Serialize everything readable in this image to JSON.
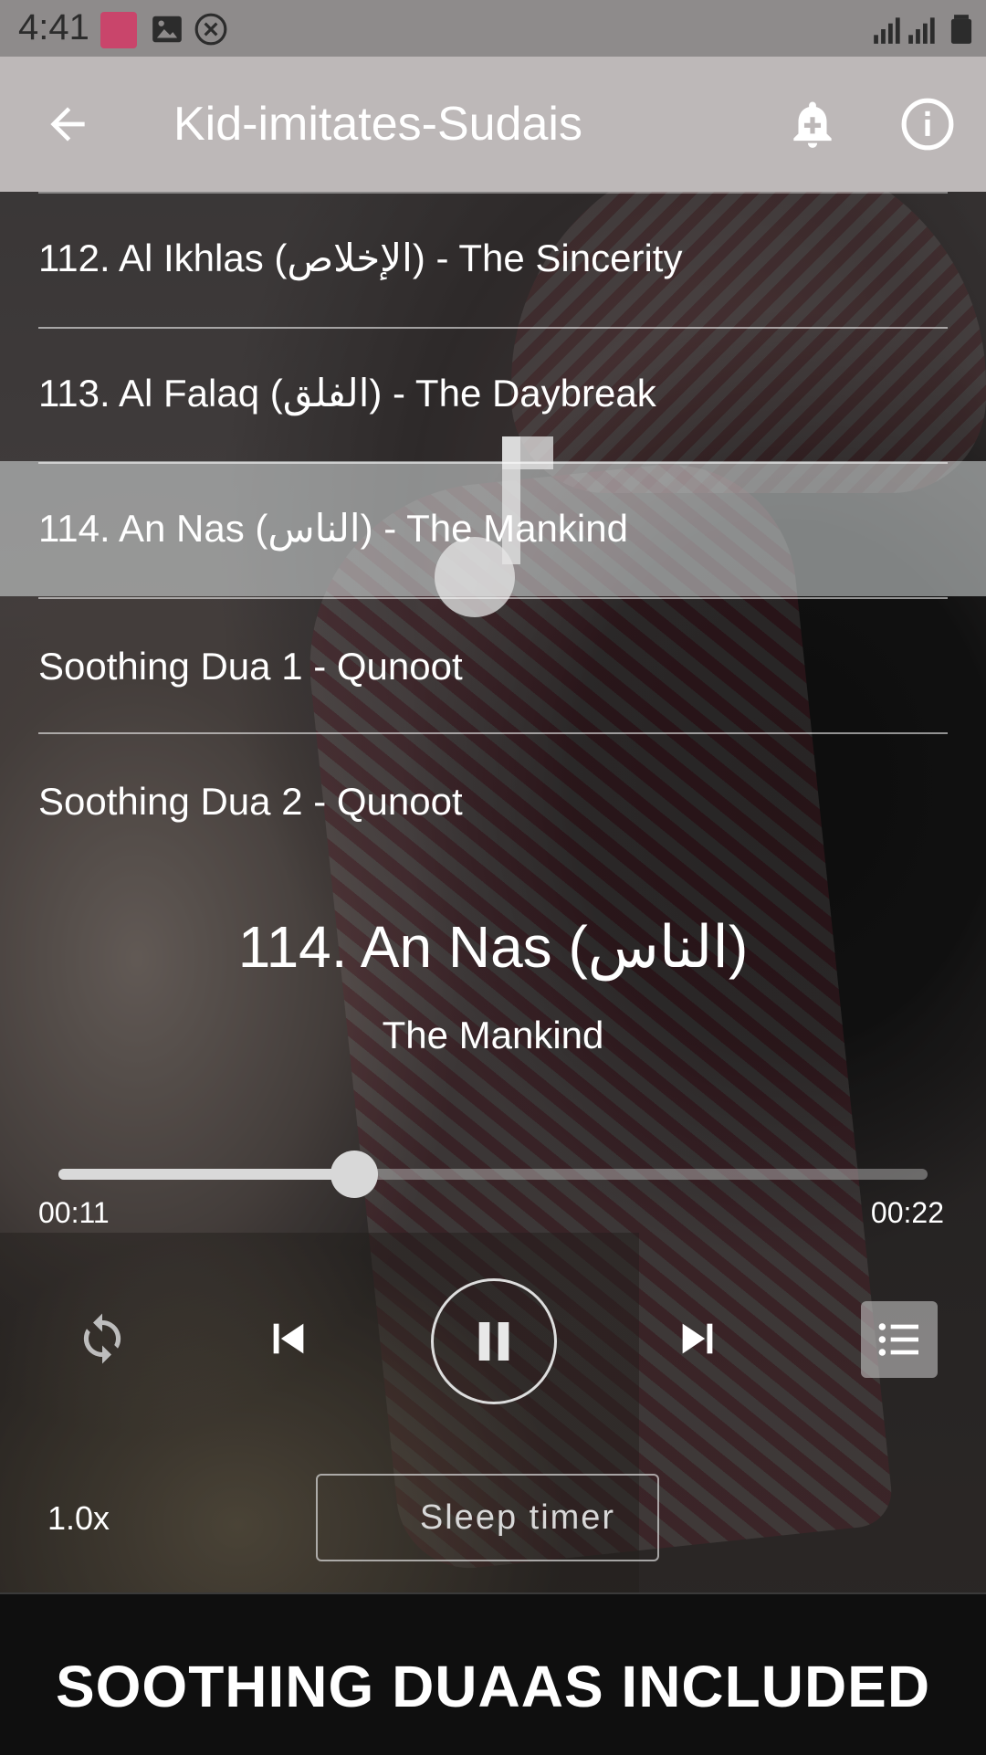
{
  "status_bar": {
    "time": "4:41",
    "icons": [
      "app-thumbnail-icon",
      "image-icon",
      "close-circle-icon",
      "signal-icon",
      "signal-roaming-icon",
      "battery-icon"
    ]
  },
  "app_bar": {
    "back_icon": "arrow-left-icon",
    "title": "Kid-imitates-Sudais",
    "alarm_icon": "alarm-add-icon",
    "info_icon": "info-icon"
  },
  "tracks": [
    {
      "label": "112. Al Ikhlas (الإخلاص) - The Sincerity"
    },
    {
      "label": "113. Al Falaq (الفلق) - The Daybreak"
    },
    {
      "label": "114. An Nas (الناس) - The Mankind"
    },
    {
      "label": "Soothing Dua 1 - Qunoot"
    },
    {
      "label": "Soothing Dua 2 - Qunoot"
    }
  ],
  "now_playing": {
    "title": "114. An Nas (الناس)",
    "subtitle": "The Mankind"
  },
  "progress": {
    "elapsed": "00:11",
    "duration": "00:22",
    "fraction": 0.34
  },
  "controls": {
    "repeat_icon": "repeat-icon",
    "prev_icon": "skip-previous-icon",
    "pause_icon": "pause-icon",
    "next_icon": "skip-next-icon",
    "playlist_icon": "playlist-icon"
  },
  "speed": "1.0x",
  "sleep_timer": {
    "label": "Sleep timer",
    "icon": "moon-icon"
  },
  "banner": "SOOTHING DUAAS INCLUDED"
}
